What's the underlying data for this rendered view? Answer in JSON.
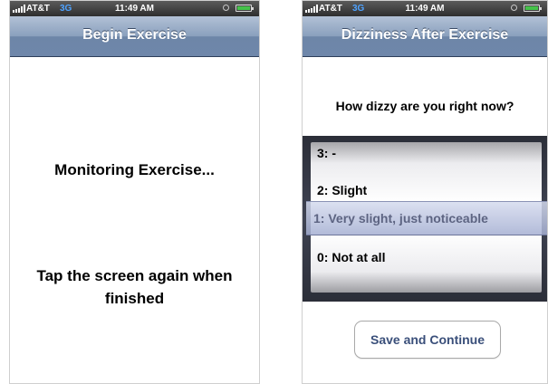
{
  "status_bar": {
    "carrier": "AT&T",
    "network": "3G",
    "time": "11:49 AM",
    "network_color": "#4fa3ff",
    "battery_color": "#45c24a",
    "battery_level": 0.85
  },
  "left_screen": {
    "title": "Begin Exercise",
    "message": "Monitoring Exercise...",
    "instruction": "Tap the screen again when finished"
  },
  "right_screen": {
    "title": "Dizziness After Exercise",
    "question": "How dizzy are you right now?",
    "picker": {
      "options": [
        "3: -",
        "2: Slight",
        "1: Very slight, just noticeable",
        "0: Not at all"
      ],
      "selected": "1: Very slight, just noticeable"
    },
    "save_button": "Save and Continue"
  },
  "colors": {
    "nav_bar": "#8aa0bd",
    "selection_highlight": "#b8c0dc",
    "button_text": "#3a4f7a"
  }
}
